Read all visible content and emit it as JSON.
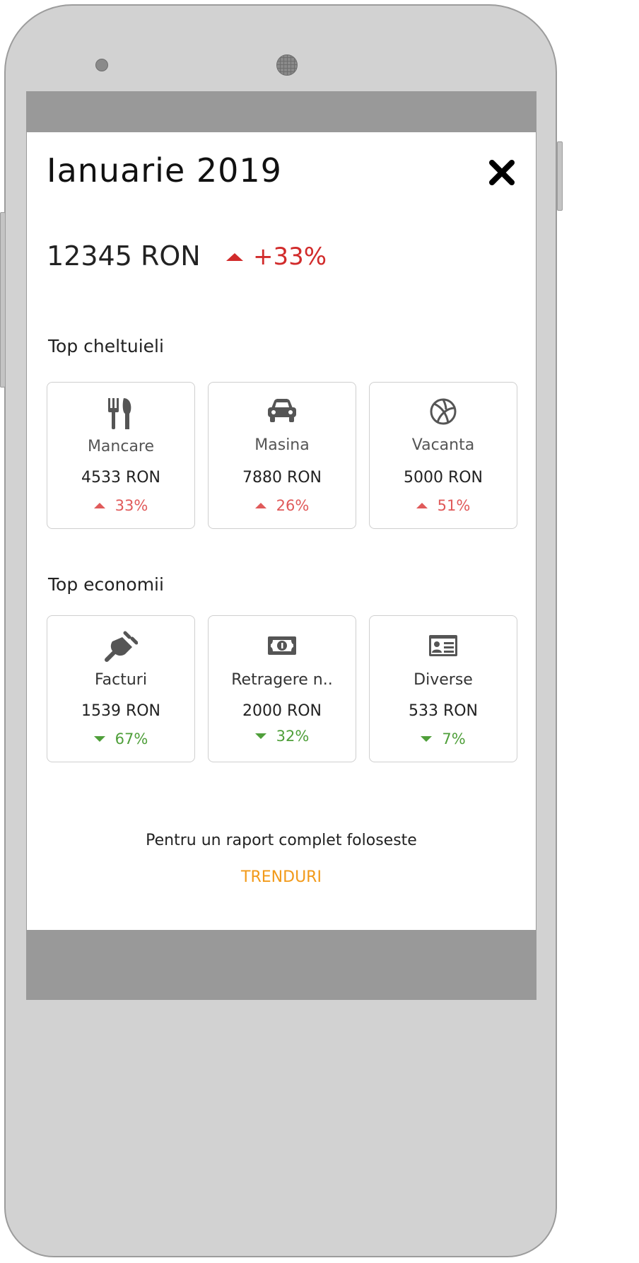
{
  "header": {
    "title": "Ianuarie 2019",
    "close_icon": "close-icon"
  },
  "summary": {
    "total": "12345 RON",
    "trend": "+33%",
    "trend_direction": "up",
    "trend_color": "#d12b2b"
  },
  "top_expenses": {
    "heading": "Top cheltuieli",
    "items": [
      {
        "icon": "cutlery-icon",
        "label": "Mancare",
        "amount": "4533 RON",
        "change": "33%",
        "direction": "up"
      },
      {
        "icon": "car-icon",
        "label": "Masina",
        "amount": "7880 RON",
        "change": "26%",
        "direction": "up"
      },
      {
        "icon": "basketball-icon",
        "label": "Vacanta",
        "amount": "5000 RON",
        "change": "51%",
        "direction": "up"
      }
    ]
  },
  "top_savings": {
    "heading": "Top economii",
    "items": [
      {
        "icon": "plug-icon",
        "label": "Facturi",
        "amount": "1539 RON",
        "change": "67%",
        "direction": "down"
      },
      {
        "icon": "money-bill-icon",
        "label": "Retragere n..",
        "amount": "2000 RON",
        "change": "32%",
        "direction": "down"
      },
      {
        "icon": "id-card-icon",
        "label": "Diverse",
        "amount": "533 RON",
        "change": "7%",
        "direction": "down"
      }
    ]
  },
  "footer": {
    "text": "Pentru un raport complet foloseste",
    "link": "TRENDURI",
    "link_color": "#f29a1a"
  },
  "colors": {
    "increase": "#e05a5a",
    "decrease": "#4f9f3a",
    "bars": "#999999"
  }
}
